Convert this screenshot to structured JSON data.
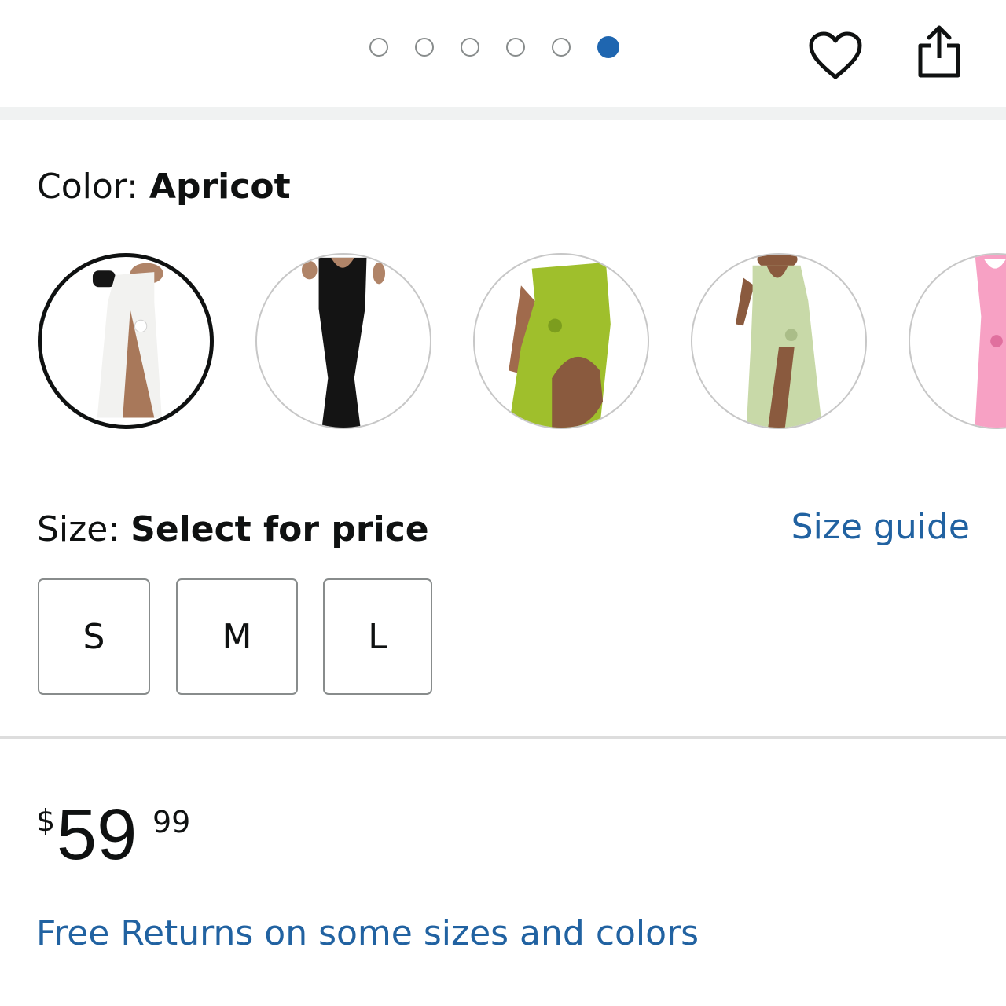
{
  "carousel": {
    "total": 6,
    "active_index": 5,
    "accent": "#1f66b0"
  },
  "actions": {
    "wishlist_icon": "heart-icon",
    "share_icon": "share-icon"
  },
  "color": {
    "label": "Color: ",
    "value": "Apricot",
    "swatches": [
      {
        "name": "white",
        "dress_color": "#f2f2f0"
      },
      {
        "name": "black",
        "dress_color": "#141414"
      },
      {
        "name": "lime",
        "dress_color": "#9fbf2c"
      },
      {
        "name": "sage",
        "dress_color": "#c8d9a8"
      },
      {
        "name": "pink",
        "dress_color": "#f7a1c4"
      }
    ]
  },
  "size": {
    "label": "Size: ",
    "value": "Select for price",
    "guide": "Size guide",
    "options": [
      "S",
      "M",
      "L"
    ]
  },
  "price": {
    "symbol": "$",
    "whole": "59",
    "fraction": "99"
  },
  "returns": {
    "text": "Free Returns on some sizes and colors"
  },
  "colors": {
    "link": "#2162a1",
    "text": "#0f1111"
  }
}
